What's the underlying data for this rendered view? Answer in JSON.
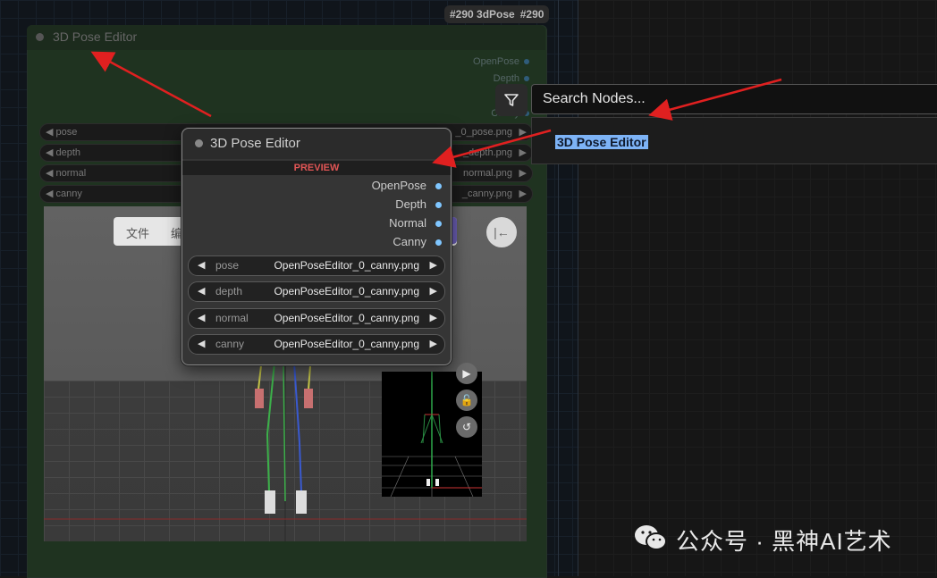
{
  "badge": {
    "id": "#290 3dPose",
    "id2": "#290"
  },
  "back_node": {
    "title": "3D Pose Editor",
    "outputs": [
      "OpenPose",
      "Depth",
      "Canny"
    ],
    "widgets": [
      {
        "label": "pose",
        "value": "_0_pose.png"
      },
      {
        "label": "depth",
        "value": "_depth.png"
      },
      {
        "label": "normal",
        "value": "normal.png"
      },
      {
        "label": "canny",
        "value": "_canny.png"
      }
    ],
    "toolbar": {
      "item1": "文件",
      "item2": "编"
    }
  },
  "node": {
    "title": "3D Pose Editor",
    "preview_label": "PREVIEW",
    "outputs": [
      "OpenPose",
      "Depth",
      "Normal",
      "Canny"
    ],
    "widgets": [
      {
        "label": "pose",
        "value": "OpenPoseEditor_0_canny.png"
      },
      {
        "label": "depth",
        "value": "OpenPoseEditor_0_canny.png"
      },
      {
        "label": "normal",
        "value": "OpenPoseEditor_0_canny.png"
      },
      {
        "label": "canny",
        "value": "OpenPoseEditor_0_canny.png"
      }
    ],
    "arrow_left": "◀",
    "arrow_right": "▶"
  },
  "search": {
    "placeholder": "Search Nodes...",
    "result": "3D Pose Editor"
  },
  "watermark": {
    "text": "公众号 · 黑神AI艺术"
  },
  "colors": {
    "accent": "#7db3f6",
    "arrow": "#e02020",
    "preview": "#e05555",
    "output_dot": "#7fc6ff"
  }
}
